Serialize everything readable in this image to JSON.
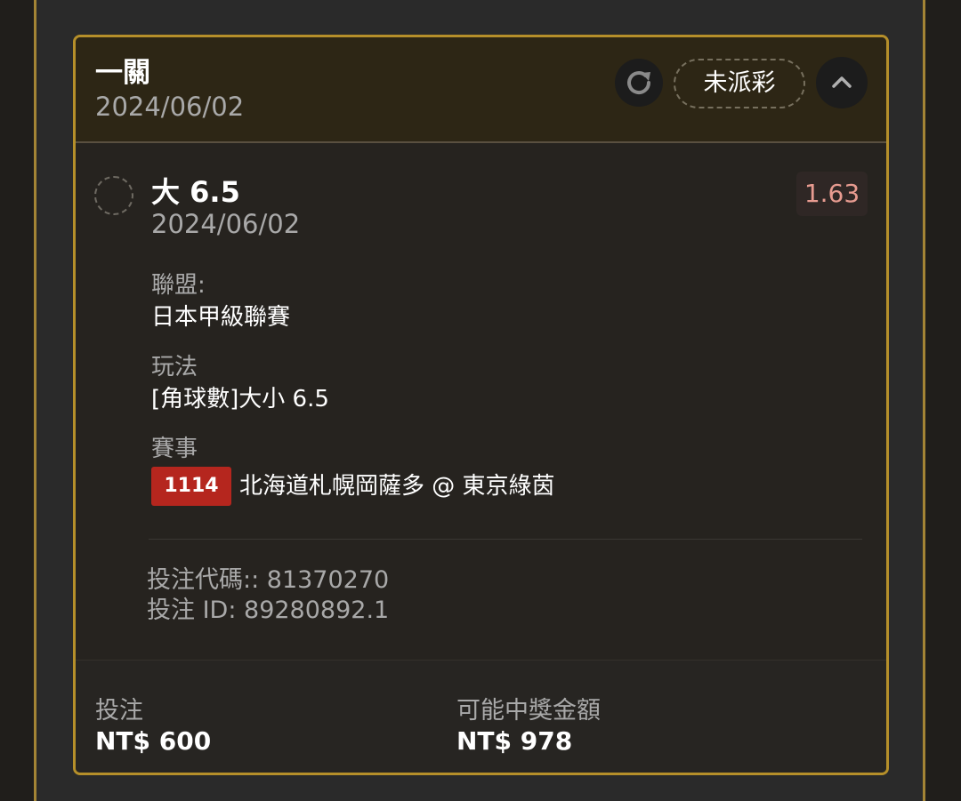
{
  "header": {
    "title": "一關",
    "date": "2024/06/02",
    "status": "未派彩",
    "refresh_icon": "refresh-icon",
    "collapse_icon": "chevron-up-icon"
  },
  "selection": {
    "title": "大 6.5",
    "date": "2024/06/02",
    "odds": "1.63",
    "league_label": "聯盟:",
    "league_value": "日本甲級聯賽",
    "market_label": "玩法",
    "market_value": "[角球數]大小 6.5",
    "event_label": "賽事",
    "event_id": "1114",
    "event_name": "北海道札幌岡薩多 @ 東京綠茵"
  },
  "codes": {
    "bet_code": "投注代碼:: 81370270",
    "bet_id": "投注 ID: 89280892.1"
  },
  "footer": {
    "stake_label": "投注",
    "stake_value": "NT$ 600",
    "payout_label": "可能中獎金額",
    "payout_value": "NT$ 978"
  },
  "colors": {
    "accent_gold": "#b58f2a",
    "odds_text": "#e79b90",
    "badge_red": "#b5261e"
  }
}
